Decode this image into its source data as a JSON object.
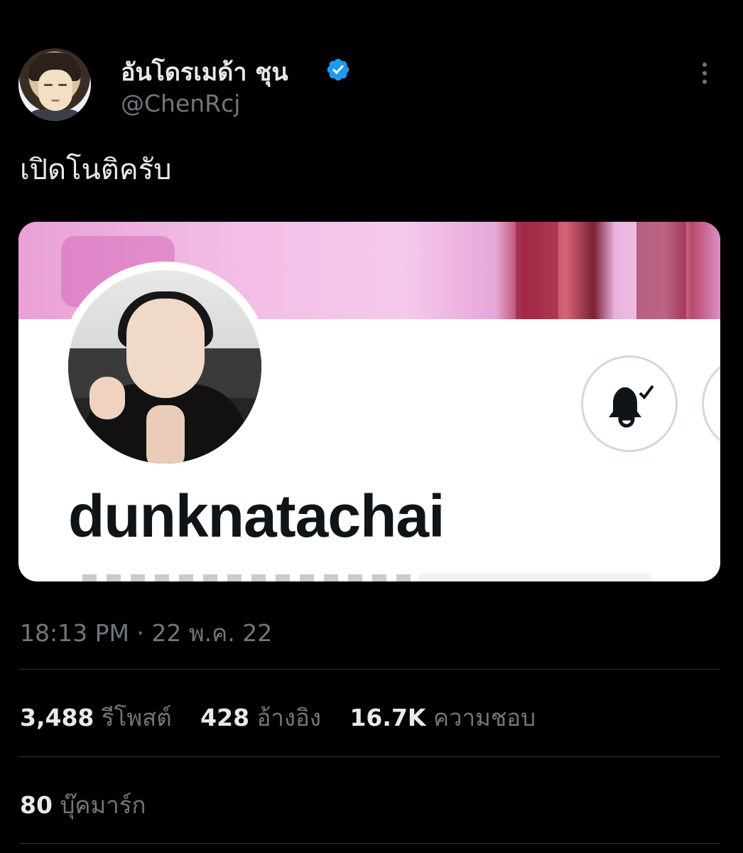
{
  "author": {
    "display_name": "อันโดรเมด้า ชุน",
    "handle": "@ChenRcj",
    "verified": true
  },
  "tweet": {
    "text": "เปิดโนติครับ"
  },
  "media_card": {
    "username": "dunknatachai"
  },
  "meta": {
    "timestamp": "18:13 PM · 22 พ.ค. 22"
  },
  "stats": {
    "retweets_count": "3,488",
    "retweets_label": "รีโพสต์",
    "quotes_count": "428",
    "quotes_label": "อ้างอิง",
    "likes_count": "16.7K",
    "likes_label": "ความชอบ",
    "bookmarks_count": "80",
    "bookmarks_label": "บุ๊คมาร์ก"
  },
  "colors": {
    "background": "#000000",
    "text_primary": "#e7e9ea",
    "text_secondary": "#71767b",
    "verified_blue": "#1d9bf0",
    "divider": "#2f3336"
  },
  "icons": {
    "verified": "verified-badge-icon",
    "more": "more-vertical-icon",
    "bell": "bell-check-icon"
  }
}
